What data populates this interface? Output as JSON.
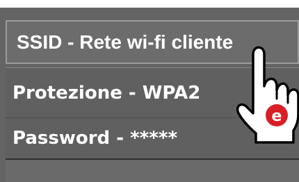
{
  "menu": {
    "ssid_label": "SSID - Rete wi-fi cliente",
    "protection_label": "Protezione - WPA2",
    "password_label": "Password - *****"
  },
  "cursor": {
    "icon": "pointing-hand-icon",
    "badge_letter": "e",
    "badge_color": "#d81f26"
  }
}
